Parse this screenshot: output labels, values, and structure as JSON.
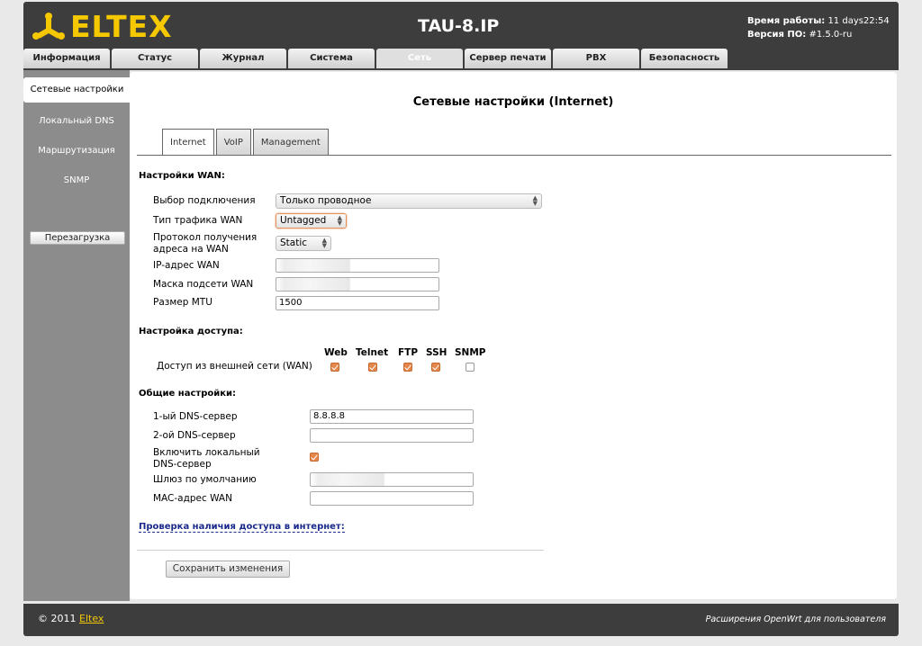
{
  "brand": {
    "logo_text": "ELTEX",
    "accent": "#f5c800"
  },
  "header": {
    "product": "TAU-8.IP",
    "uptime_label": "Время работы:",
    "uptime_value": "11 days22:54",
    "version_label": "Версия ПО:",
    "version_value": "#1.5.0-ru"
  },
  "tabs": [
    {
      "label": "Информация"
    },
    {
      "label": "Статус"
    },
    {
      "label": "Журнал"
    },
    {
      "label": "Система"
    },
    {
      "label": "Сеть"
    },
    {
      "label": "Сервер печати"
    },
    {
      "label": "PBX"
    },
    {
      "label": "Безопасность"
    }
  ],
  "sidebar": {
    "items": [
      {
        "label": "Сетевые настройки"
      },
      {
        "label": "Локальный DNS"
      },
      {
        "label": "Маршрутизация"
      },
      {
        "label": "SNMP"
      }
    ],
    "reboot": "Перезагрузка"
  },
  "page": {
    "title": "Сетевые настройки (Internet)",
    "subtabs": [
      "Internet",
      "VoIP",
      "Management"
    ]
  },
  "wan": {
    "heading": "Настройки WAN:",
    "conn_label": "Выбор подключения",
    "conn_value": "Только проводное",
    "traffic_label": "Тип трафика WAN",
    "traffic_value": "Untagged",
    "proto_label_1": "Протокол получения",
    "proto_label_2": "адреса на WAN",
    "proto_value": "Static",
    "ip_label": "IP-адрес WAN",
    "mask_label": "Маска подсети WAN",
    "mtu_label": "Размер MTU",
    "mtu_value": "1500"
  },
  "access": {
    "heading": "Настройка доступа:",
    "cols": [
      "Web",
      "Telnet",
      "FTP",
      "SSH",
      "SNMP"
    ],
    "row_label": "Доступ из внешней сети (WAN)",
    "checked": [
      true,
      true,
      true,
      true,
      false
    ]
  },
  "general": {
    "heading": "Общие настройки:",
    "dns1_label": "1-ый DNS-сервер",
    "dns1_value": "8.8.8.8",
    "dns2_label": "2-ой DNS-сервер",
    "dns2_value": "",
    "local_dns_label_1": "Включить локальный",
    "local_dns_label_2": "DNS-сервер",
    "local_dns_checked": true,
    "gw_label": "Шлюз по умолчанию",
    "mac_label": "MAC-адрес WAN",
    "mac_value": ""
  },
  "link": "Проверка наличия доступа в интернет:",
  "save": "Сохранить изменения",
  "footer": {
    "copyright": "© 2011",
    "copyright_link": "Eltex",
    "right": "Расширения OpenWrt для пользователя"
  }
}
